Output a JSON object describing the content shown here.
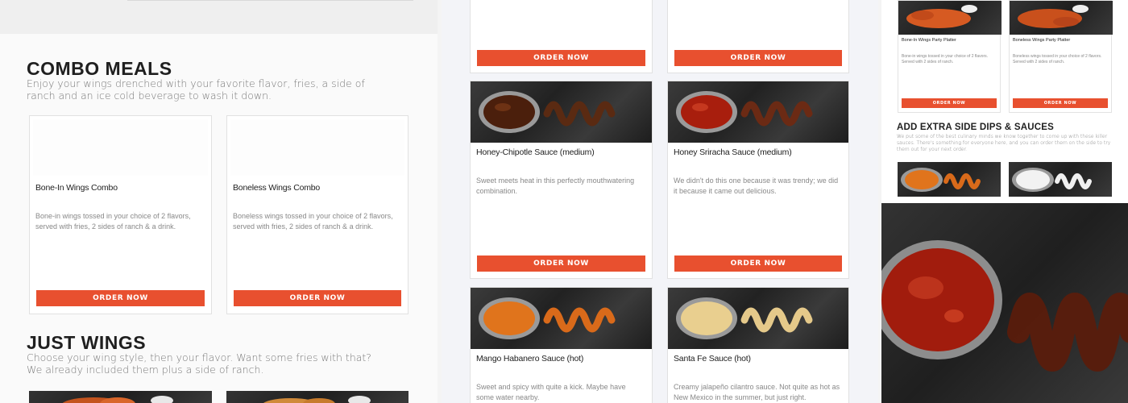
{
  "combo": {
    "title": "COMBO MEALS",
    "desc": "Enjoy your wings drenched with your favorite flavor, fries, a side of ranch and an ice cold beverage to wash it down.",
    "cards": [
      {
        "name": "Bone-In Wings Combo",
        "desc": "Bone-in wings tossed in your choice of 2 flavors, served with fries, 2 sides of ranch & a drink.",
        "button": "ORDER NOW"
      },
      {
        "name": "Boneless Wings Combo",
        "desc": "Boneless wings tossed in your choice of 2 flavors, served with fries, 2 sides of ranch & a drink.",
        "button": "ORDER NOW"
      }
    ]
  },
  "just_wings": {
    "title": "JUST WINGS",
    "desc": "Choose your wing style, then your flavor. Want some fries with that? We already included them plus a side of ranch."
  },
  "sauces": {
    "top_buttons": [
      "ORDER NOW",
      "ORDER NOW"
    ],
    "cards": [
      {
        "name": "Honey-Chipotle Sauce (medium)",
        "desc": "Sweet meets heat in this perfectly mouthwatering combination.",
        "button": "ORDER NOW",
        "color": "#5a2a12"
      },
      {
        "name": "Honey Sriracha Sauce (medium)",
        "desc": "We didn't do this one because it was trendy; we did it because it came out delicious.",
        "button": "ORDER NOW",
        "color": "#b5210f"
      },
      {
        "name": "Mango Habanero Sauce (hot)",
        "desc": "Sweet and spicy with quite a kick. Maybe have some water nearby.",
        "color": "#e0741c"
      },
      {
        "name": "Santa Fe Sauce (hot)",
        "desc": "Creamy jalapeño cilantro sauce. Not quite as hot as New Mexico in the summer, but just right.",
        "color": "#e9cf8f"
      }
    ]
  },
  "mini": {
    "platters": [
      {
        "name": "Bone-In Wings Party Platter",
        "desc": "Bone-in wings tossed in your choice of 2 flavors. Served with 2 sides of ranch.",
        "button": "ORDER NOW"
      },
      {
        "name": "Boneless Wings Party Platter",
        "desc": "Boneless wings tossed in your choice of 2 flavors. Served with 2 sides of ranch.",
        "button": "ORDER NOW"
      }
    ],
    "dips_title": "ADD EXTRA SIDE DIPS & SAUCES",
    "dips_desc": "We put some of the best culinary minds we know together to come up with these killer sauces. There's something for everyone here, and you can order them on the side to try them out for your next order."
  },
  "colors": {
    "accent": "#e8502f",
    "dark_bg": "#2a2a2a"
  }
}
